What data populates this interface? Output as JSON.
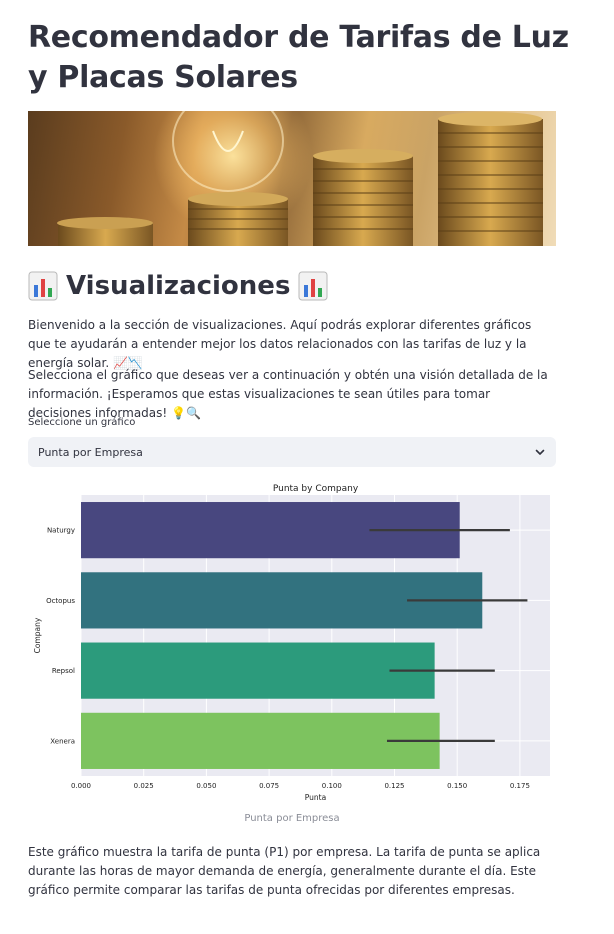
{
  "page": {
    "title": "Recomendador de Tarifas de Luz y Placas Solares"
  },
  "section": {
    "heading": "Visualizaciones",
    "heading_icon": "bar-chart-emoji"
  },
  "intro": {
    "p1": "Bienvenido a la sección de visualizaciones. Aquí podrás explorar diferentes gráficos que te ayudarán a entender mejor los datos relacionados con las tarifas de luz y la energía solar. 📈📉",
    "p2": "Selecciona el gráfico que deseas ver a continuación y obtén una visión detallada de la información. ¡Esperamos que estas visualizaciones te sean útiles para tomar decisiones informadas! 💡🔍"
  },
  "selector": {
    "label": "Seleccione un gráfico",
    "value": "Punta por Empresa",
    "icon": "chevron-down-icon"
  },
  "chart_caption": "Punta por Empresa",
  "description": "Este gráfico muestra la tarifa de punta (P1) por empresa. La tarifa de punta se aplica durante las horas de mayor demanda de energía, generalmente durante el día. Este gráfico permite comparar las tarifas de punta ofrecidas por diferentes empresas.",
  "chart_data": {
    "type": "bar",
    "orientation": "horizontal",
    "title": "Punta by Company",
    "xlabel": "Punta",
    "ylabel": "Company",
    "categories": [
      "Naturgy",
      "Octopus",
      "Repsol",
      "Xenera"
    ],
    "values": [
      0.151,
      0.16,
      0.141,
      0.143
    ],
    "error_low": [
      0.115,
      0.13,
      0.123,
      0.122
    ],
    "error_high": [
      0.171,
      0.178,
      0.165,
      0.165
    ],
    "colors": [
      "#48477f",
      "#32727f",
      "#2c9b7c",
      "#7dc35f"
    ],
    "xlim": [
      0,
      0.187
    ],
    "xticks": [
      "0.000",
      "0.025",
      "0.050",
      "0.075",
      "0.100",
      "0.125",
      "0.150",
      "0.175"
    ],
    "grid": true,
    "background": "#eaeaf2"
  }
}
